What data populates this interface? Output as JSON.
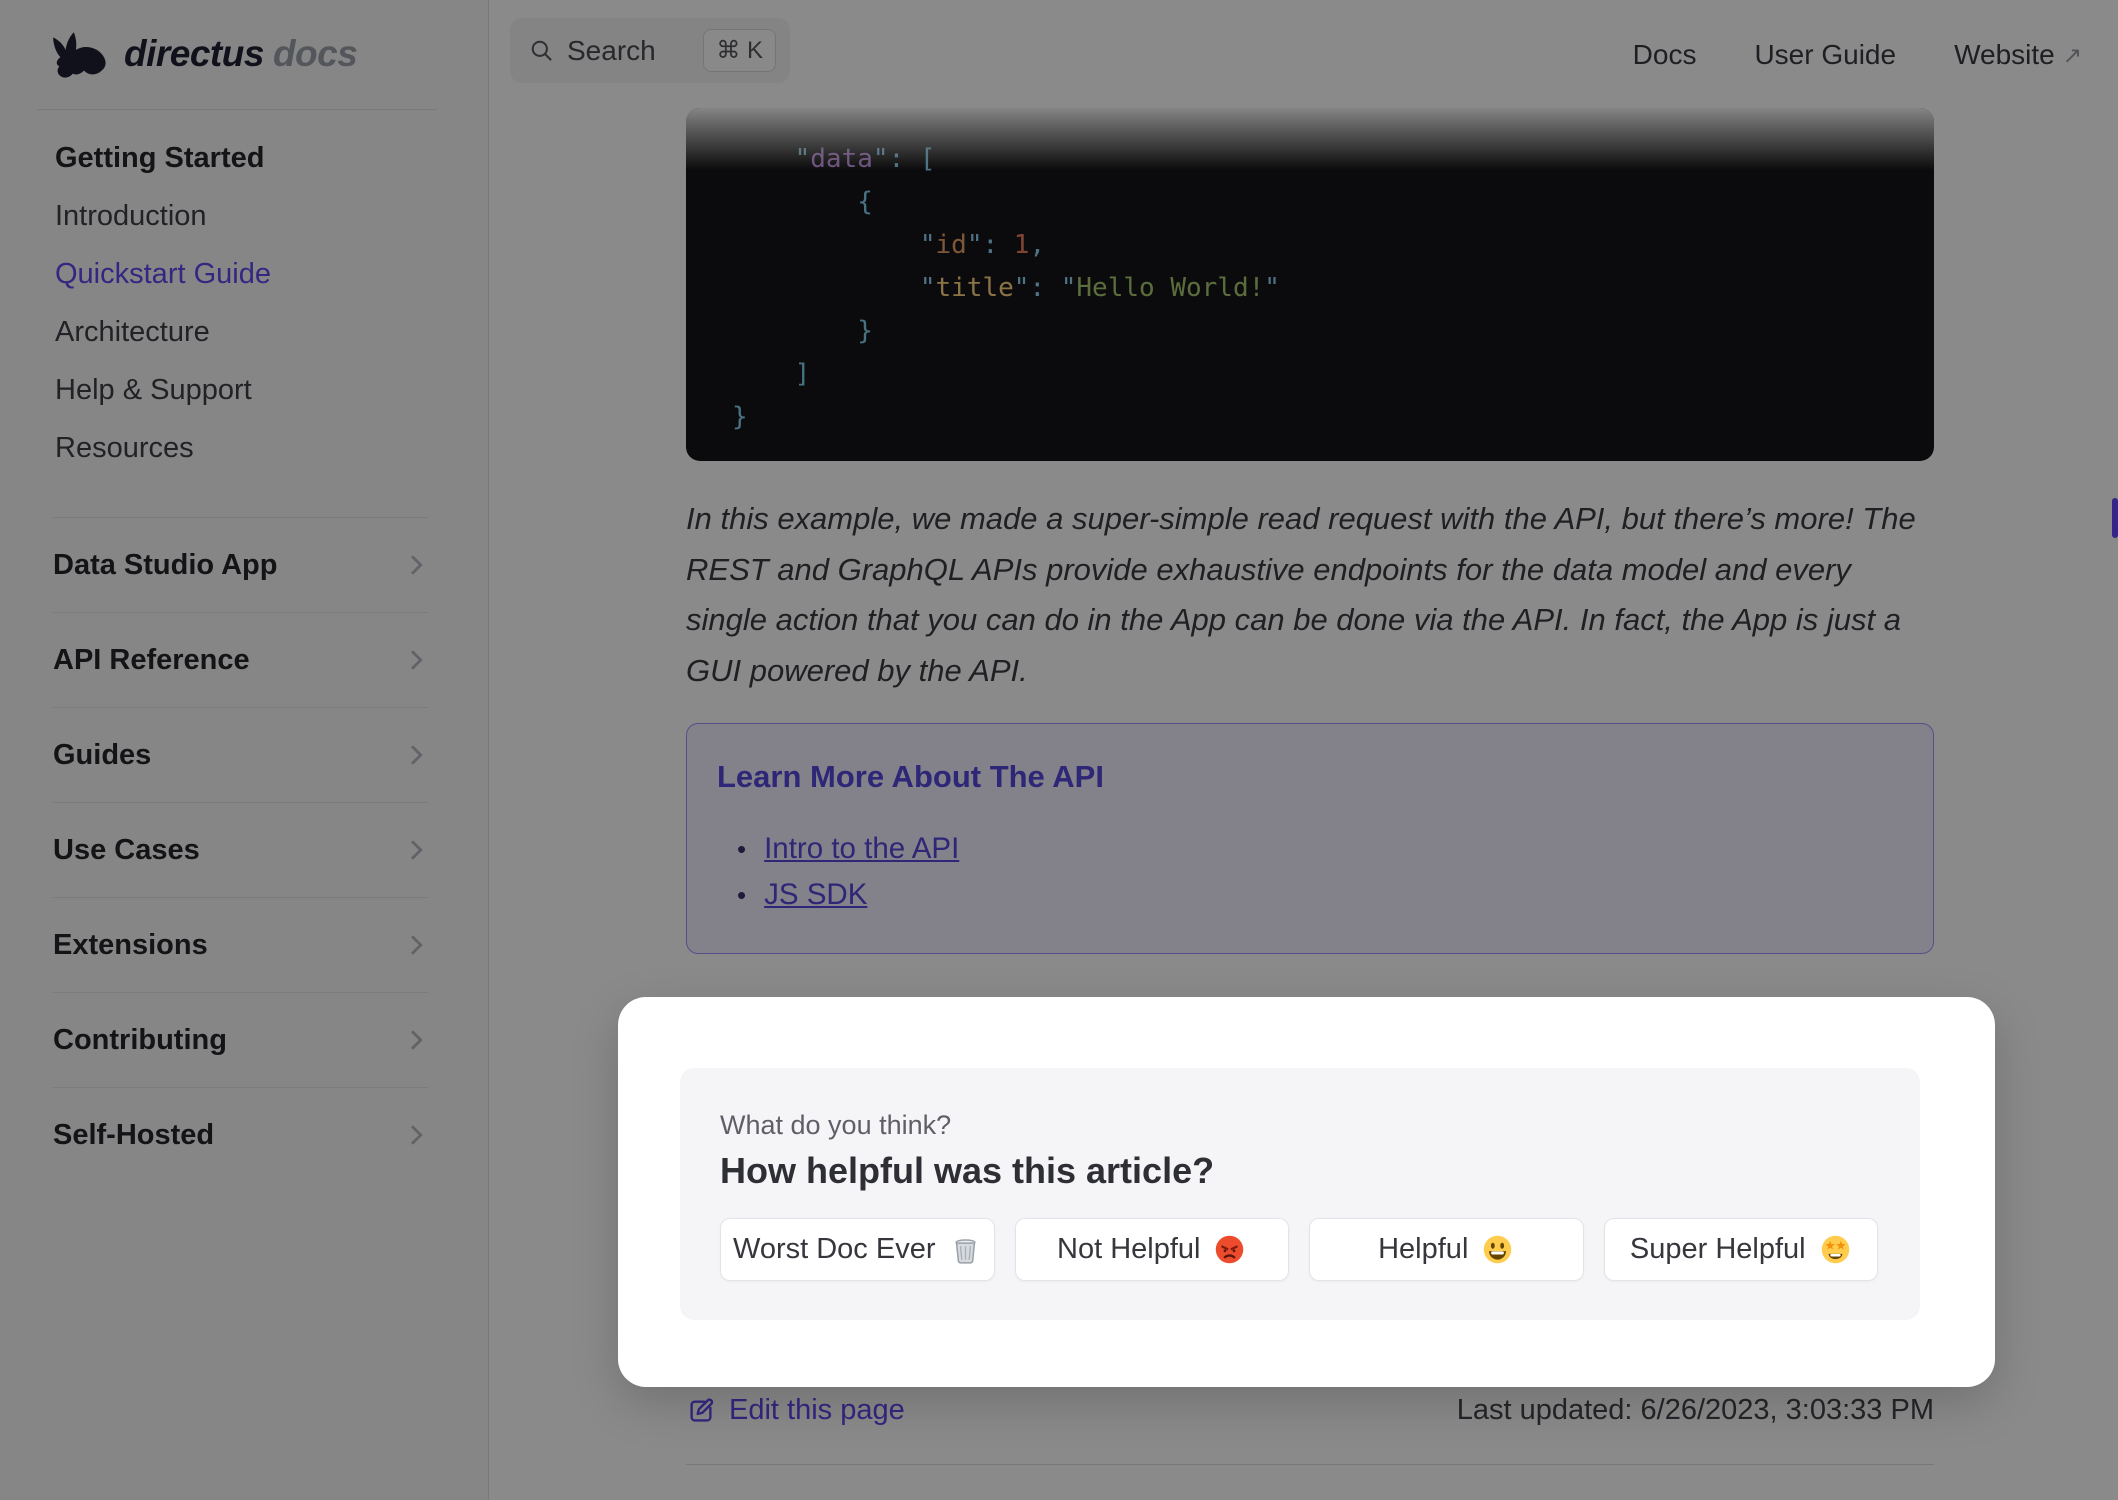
{
  "brand": {
    "name": "directus",
    "suffix": "docs"
  },
  "header": {
    "search": {
      "label": "Search",
      "shortcut": "⌘ K"
    },
    "nav": [
      {
        "label": "Docs"
      },
      {
        "label": "User Guide"
      },
      {
        "label": "Website",
        "external_arrow": "↗"
      }
    ]
  },
  "sidebar": {
    "top_items": [
      {
        "label": "Getting Started"
      },
      {
        "label": "Introduction"
      },
      {
        "label": "Quickstart Guide"
      },
      {
        "label": "Architecture"
      },
      {
        "label": "Help & Support"
      },
      {
        "label": "Resources"
      }
    ],
    "sections": [
      {
        "label": "Data Studio App"
      },
      {
        "label": "API Reference"
      },
      {
        "label": "Guides"
      },
      {
        "label": "Use Cases"
      },
      {
        "label": "Extensions"
      },
      {
        "label": "Contributing"
      },
      {
        "label": "Self-Hosted"
      }
    ]
  },
  "code_block": {
    "language": "json",
    "lines": [
      [
        [
          "    ",
          "sp"
        ],
        [
          "\"",
          "q"
        ],
        [
          "data",
          "kp"
        ],
        [
          "\"",
          "q"
        ],
        [
          ": ",
          "q"
        ],
        [
          "[",
          "b"
        ]
      ],
      [
        [
          "        ",
          "sp"
        ],
        [
          "{",
          "b"
        ]
      ],
      [
        [
          "            ",
          "sp"
        ],
        [
          "\"",
          "q"
        ],
        [
          "id",
          "ko"
        ],
        [
          "\"",
          "q"
        ],
        [
          ": ",
          "q"
        ],
        [
          "1",
          "o"
        ],
        [
          ",",
          "q"
        ]
      ],
      [
        [
          "            ",
          "sp"
        ],
        [
          "\"",
          "q"
        ],
        [
          "title",
          "ky"
        ],
        [
          "\"",
          "q"
        ],
        [
          ": ",
          "q"
        ],
        [
          "\"",
          "q"
        ],
        [
          "Hello World!",
          "g"
        ],
        [
          "\"",
          "q"
        ]
      ],
      [
        [
          "        ",
          "sp"
        ],
        [
          "}",
          "b"
        ]
      ],
      [
        [
          "    ",
          "sp"
        ],
        [
          "]",
          "b"
        ]
      ],
      [
        [
          "}",
          "b"
        ]
      ]
    ]
  },
  "article": {
    "paragraph": "In this example, we made a super-simple read request with the API, but there’s more! The REST and GraphQL APIs provide exhaustive endpoints for the data model and every single action that you can do in the App can be done via the API. In fact, the App is just a GUI powered by the API.",
    "info_box": {
      "title": "Learn More About The API",
      "bullet": "•",
      "links": [
        {
          "label": "Intro to the API"
        },
        {
          "label": "JS SDK"
        }
      ]
    }
  },
  "feedback": {
    "kicker": "What do you think?",
    "question": "How helpful was this article?",
    "options": [
      {
        "label": "Worst Doc Ever",
        "emoji": "🗑️",
        "emoji_name": "wastebasket"
      },
      {
        "label": "Not Helpful",
        "emoji": "😡",
        "emoji_name": "enraged-face"
      },
      {
        "label": "Helpful",
        "emoji": "😃",
        "emoji_name": "grinning-face"
      },
      {
        "label": "Super Helpful",
        "emoji": "🤩",
        "emoji_name": "star-struck-face"
      }
    ]
  },
  "footer": {
    "edit_label": "Edit this page",
    "last_updated": "Last updated: 6/26/2023, 3:03:33 PM"
  },
  "colors": {
    "brand": "#6644ff",
    "code_background": "#161618",
    "overlay": "rgba(0,0,0,0.458)",
    "sidebar_background": "#f8f8fa",
    "card_background": "#f5f5f7",
    "info_box_background": "#f2efff"
  }
}
